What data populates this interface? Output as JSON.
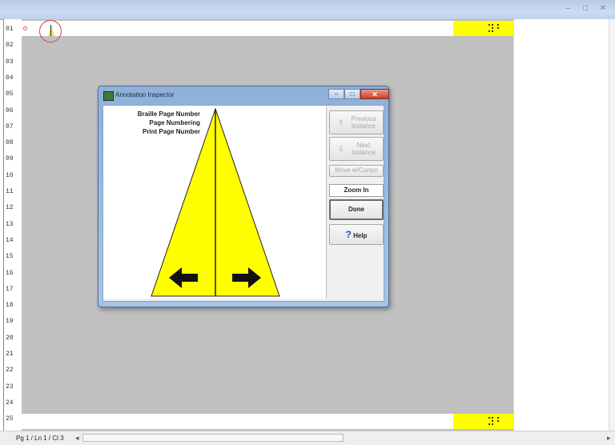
{
  "window": {
    "controls": [
      "–",
      "□",
      "✕"
    ]
  },
  "line_numbers": [
    "01",
    "02",
    "03",
    "04",
    "05",
    "06",
    "07",
    "08",
    "09",
    "10",
    "11",
    "12",
    "13",
    "14",
    "15",
    "16",
    "17",
    "18",
    "19",
    "20",
    "21",
    "22",
    "23",
    "24",
    "25"
  ],
  "status": {
    "position": "Pg 1 / Ln 1 / Cl 3",
    "scroll_left": "◂",
    "scroll_right": "▸"
  },
  "dialog": {
    "title": "Annotation Inspector",
    "labels": [
      "Braille Page Number",
      "Page Numbering",
      "Print Page Number"
    ],
    "buttons": {
      "previous_instance": "Previous Instance",
      "next_instance": "Next Instance",
      "move_cursor": "Move w/Cursor",
      "zoom_in": "Zoom In",
      "done": "Done",
      "help": "Help"
    },
    "icons": {
      "previous_instance": "⇧",
      "next_instance": "⇩",
      "help": "?"
    },
    "colors": {
      "preview_fill": "#ffff00",
      "arrow": "#111111"
    }
  },
  "colors": {
    "braille_highlight": "#ffff00",
    "document_bg": "#c0c0c0",
    "marker_ring": "#d04040"
  }
}
